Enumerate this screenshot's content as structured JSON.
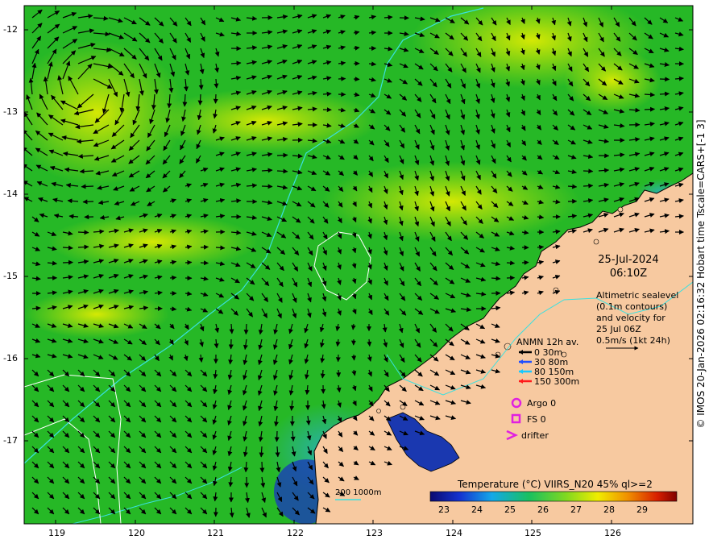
{
  "map": {
    "date": "25-Jul-2024",
    "time": "06:10Z",
    "altimetry_text": [
      "Altimetric sealevel",
      "(0.1m contours)",
      "and velocity for",
      "25 Jul 06Z",
      "0.5m/s (1kt 24h)"
    ],
    "anmn_title": "ANMN 12h av.",
    "anmn_depths": [
      {
        "label": "0 30m",
        "color": "#000000"
      },
      {
        "label": "30 80m",
        "color": "#1f4fff"
      },
      {
        "label": "80 150m",
        "color": "#19c8ff"
      },
      {
        "label": "150 300m",
        "color": "#ff1a1a"
      }
    ],
    "argo_label": "Argo 0",
    "fs_label": "FS 0",
    "drifter_label": "drifter",
    "marker_color": "#e020e0",
    "scale_label": "200  1000m",
    "colorbar_title": "Temperature (°C) VIIRS_N20 45% ql>=2",
    "colorbar_ticks": [
      "23",
      "24",
      "25",
      "26",
      "27",
      "28",
      "29"
    ],
    "lat_labels": [
      "-12",
      "-13",
      "-14",
      "-15",
      "-16",
      "-17"
    ],
    "lon_labels": [
      "119",
      "120",
      "121",
      "122",
      "123",
      "124",
      "125",
      "126"
    ],
    "side_credit": "© IMOS 20-Jan-2026 02:16:32 Hobart time Tscale=CARS+[-1 3]",
    "colors": {
      "land": "#f7c9a0",
      "ocean": "#22b522",
      "warm": "#d8e800",
      "cool": "#2aa4c8",
      "deep": "#14237a"
    }
  }
}
